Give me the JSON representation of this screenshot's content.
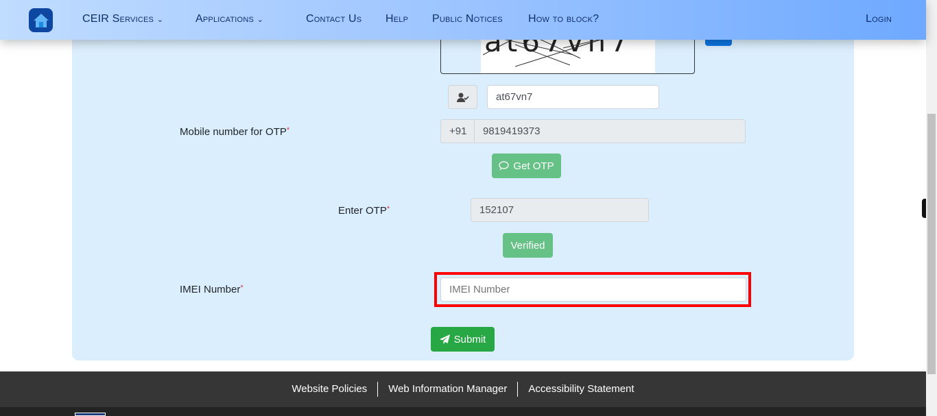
{
  "nav": {
    "items": [
      {
        "label": "CEIR Services",
        "dropdown": true
      },
      {
        "label": "Applications",
        "dropdown": true
      },
      {
        "label": "Contact Us"
      },
      {
        "label": "Help"
      },
      {
        "label": "Public Notices"
      },
      {
        "label": "How to block?"
      }
    ],
    "login": "Login"
  },
  "captcha": {
    "value": "at67vn7"
  },
  "mobile": {
    "label": "Mobile number for OTP",
    "prefix": "+91",
    "value": "9819419373"
  },
  "get_otp": "Get OTP",
  "otp": {
    "label": "Enter OTP",
    "value": "152107"
  },
  "verified": "Verified",
  "imei": {
    "label": "IMEI Number",
    "placeholder": "IMEI Number",
    "value": ""
  },
  "submit": "Submit",
  "footer": {
    "links": [
      "Website Policies",
      "Web Information Manager",
      "Accessibility Statement"
    ]
  },
  "colors": {
    "highlight": "#ff0000",
    "success": "#28a745",
    "card": "#dbeefd"
  }
}
